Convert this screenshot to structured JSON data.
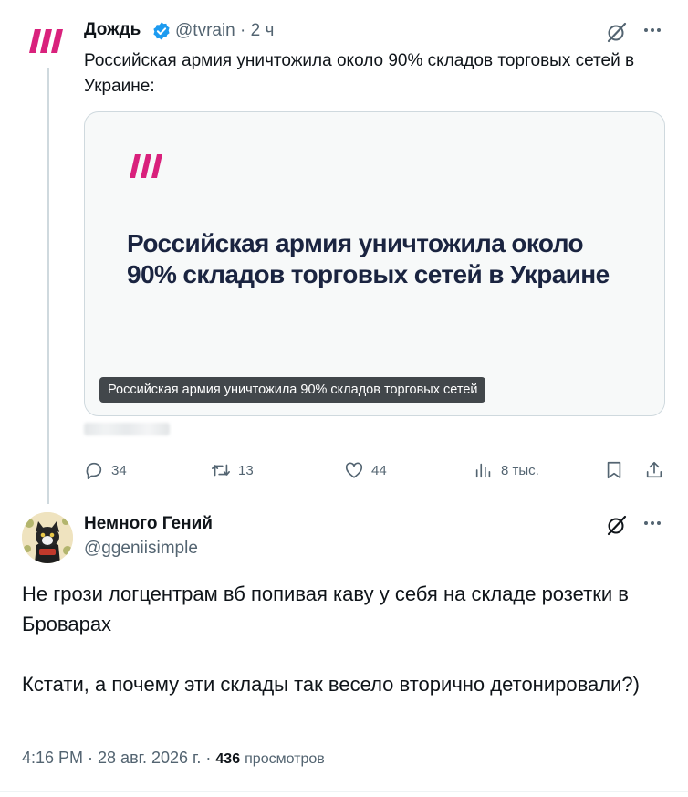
{
  "colors": {
    "text_primary": "#0f1419",
    "text_secondary": "#536471",
    "verified_blue": "#1d9bf0",
    "rain_magenta": "#d9217c",
    "card_headline": "#1a2440"
  },
  "tweet": {
    "author_name": "Дождь",
    "handle_time": "@tvrain · 2 ч",
    "text": "Российская армия уничтожила около 90% складов торговых сетей в Украине:",
    "verified_icon": "verified-badge-icon",
    "card": {
      "headline": "Российская армия уничтожила около 90% складов торговых сетей в Украине",
      "caption": "Российская армия уничтожила 90% складов торговых сетей"
    },
    "actions": {
      "replies": "34",
      "retweets": "13",
      "likes": "44",
      "views": "8 тыс."
    }
  },
  "reply": {
    "author_name": "Немного Гений",
    "handle": "@ggeniisimple",
    "paragraphs": [
      "Не грози логцентрам вб попивая каву у себя на складе розетки в Броварах",
      "Кстати, а почему эти склады так весело вторично детонировали?)"
    ],
    "meta_time": "4:16 PM · 28 авг. 2026 г. · ",
    "views_count": "436",
    "views_label": "просмотров"
  }
}
